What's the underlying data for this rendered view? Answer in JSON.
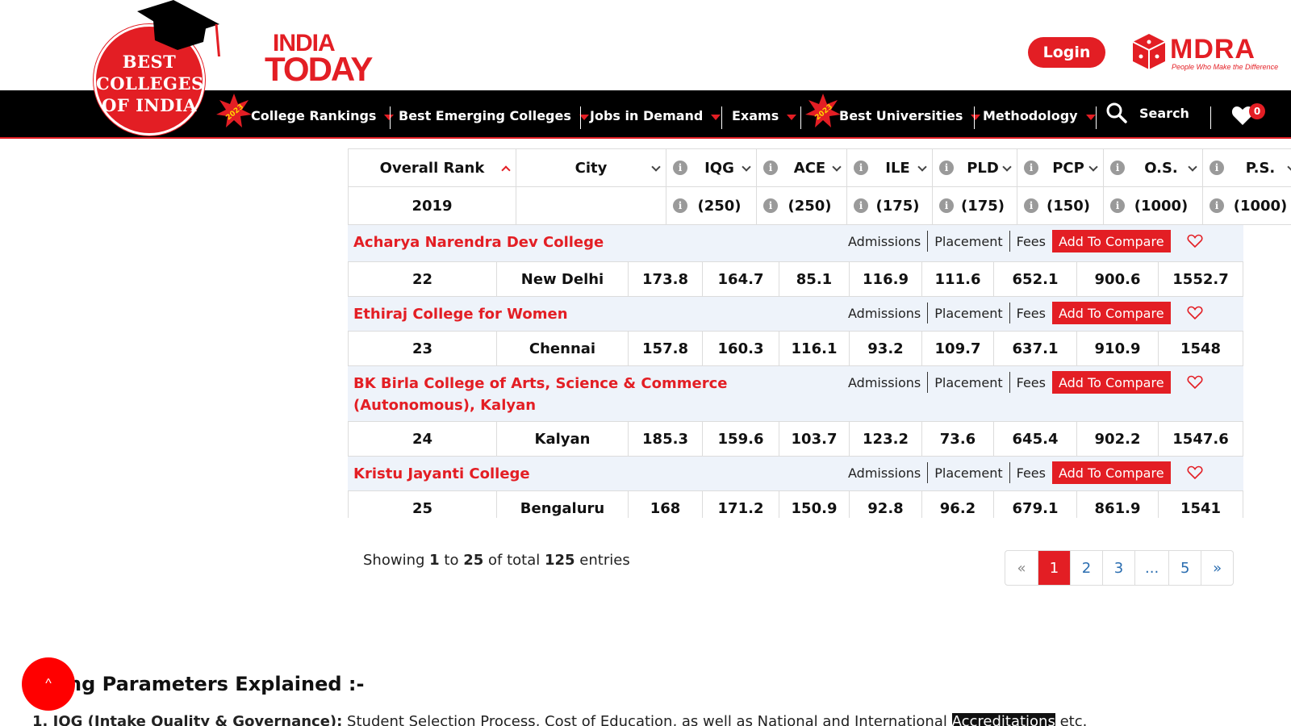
{
  "header": {
    "logo_lines": [
      "BEST",
      "COLLEGES",
      "OF INDIA"
    ],
    "brand": {
      "line1": "INDIA",
      "line2": "TODAY"
    },
    "login_label": "Login",
    "partner": {
      "name": "MDRA",
      "tagline": "People Who Make the Difference"
    }
  },
  "nav": {
    "items": [
      {
        "label": "College Rankings"
      },
      {
        "label": "Best Emerging Colleges"
      },
      {
        "label": "Jobs in Demand"
      },
      {
        "label": "Exams"
      },
      {
        "label": "Best Universities"
      },
      {
        "label": "Methodology"
      }
    ],
    "badge_year": "2023",
    "search_label": "Search",
    "wishlist_count": "0"
  },
  "table": {
    "headers": {
      "rank": "Overall Rank",
      "city": "City",
      "cols": [
        "IQG",
        "ACE",
        "ILE",
        "PLD",
        "PCP",
        "O.S.",
        "P.S."
      ]
    },
    "subheaders": {
      "rank": "2019",
      "max": [
        "(250)",
        "(250)",
        "(175)",
        "(175)",
        "(150)",
        "(1000)",
        "(1000)"
      ]
    },
    "row_actions": [
      "Admissions",
      "Placement",
      "Fees"
    ],
    "compare_label": "Add To Compare",
    "rows": [
      {
        "name": "Acharya Narendra Dev College",
        "rank": "22",
        "city": "New Delhi",
        "values": [
          "173.8",
          "164.7",
          "85.1",
          "116.9",
          "111.6",
          "652.1",
          "900.6",
          "1552.7"
        ]
      },
      {
        "name": "Ethiraj College for Women",
        "rank": "23",
        "city": "Chennai",
        "values": [
          "157.8",
          "160.3",
          "116.1",
          "93.2",
          "109.7",
          "637.1",
          "910.9",
          "1548"
        ]
      },
      {
        "name": "BK Birla College of Arts, Science & Commerce (Autonomous), Kalyan",
        "rank": "24",
        "city": "Kalyan",
        "values": [
          "185.3",
          "159.6",
          "103.7",
          "123.2",
          "73.6",
          "645.4",
          "902.2",
          "1547.6"
        ]
      },
      {
        "name": "Kristu Jayanti College",
        "rank": "25",
        "city": "Bengaluru",
        "values": [
          "168",
          "171.2",
          "150.9",
          "92.8",
          "96.2",
          "679.1",
          "861.9",
          "1541"
        ]
      }
    ]
  },
  "pagination": {
    "showing_prefix": "Showing",
    "from": "1",
    "to_word": "to",
    "to": "25",
    "of_total": "of total",
    "total": "125",
    "entries": "entries",
    "pages": [
      "«",
      "1",
      "2",
      "3",
      "...",
      "5",
      "»"
    ]
  },
  "params": {
    "heading": "ng Parameters Explained :-",
    "line_bold": "1. IQG (Intake Quality & Governance):",
    "line_text": " Student Selection Process, Cost of Education, as well as National and International ",
    "line_highlight": "Accreditations",
    "line_tail": " etc."
  },
  "scroll_top_label": "^"
}
